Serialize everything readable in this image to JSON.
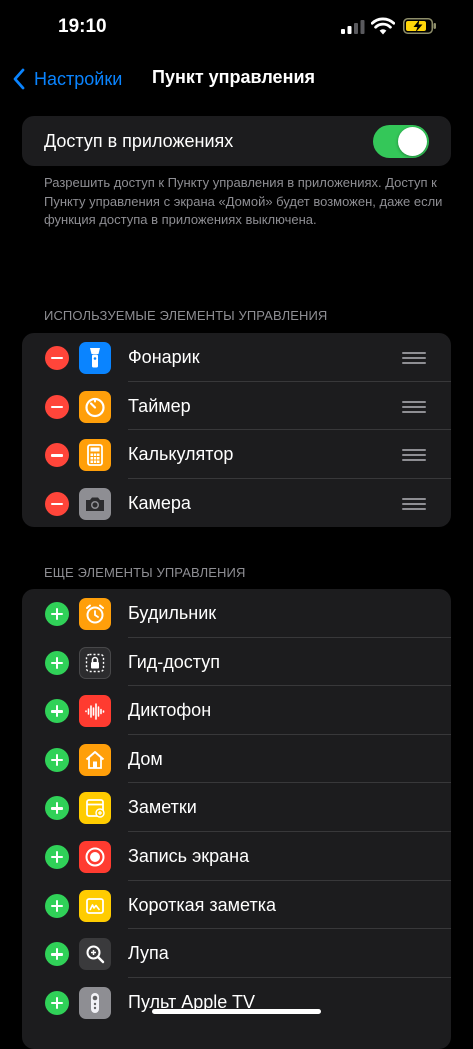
{
  "status_bar": {
    "time": "19:10"
  },
  "nav": {
    "back_label": "Настройки",
    "title": "Пункт управления"
  },
  "access": {
    "label": "Доступ в приложениях",
    "enabled": true,
    "footnote": "Разрешить доступ к Пункту управления в приложениях. Доступ к Пункту управления с экрана «Домой» будет возможен, даже если функция доступа в приложениях выключена."
  },
  "included": {
    "header": "ИСПОЛЬЗУЕМЫЕ ЭЛЕМЕНТЫ УПРАВЛЕНИЯ",
    "items": [
      {
        "label": "Фонарик",
        "icon": "flashlight-icon",
        "color": "#0a84ff"
      },
      {
        "label": "Таймер",
        "icon": "timer-icon",
        "color": "#ff9f0a"
      },
      {
        "label": "Калькулятор",
        "icon": "calculator-icon",
        "color": "#ff9f0a"
      },
      {
        "label": "Камера",
        "icon": "camera-icon",
        "color": "#8e8e93"
      }
    ]
  },
  "more": {
    "header": "ЕЩЕ ЭЛЕМЕНТЫ УПРАВЛЕНИЯ",
    "items": [
      {
        "label": "Будильник",
        "icon": "alarm-icon",
        "color": "#ff9f0a"
      },
      {
        "label": "Гид-доступ",
        "icon": "guided-access-icon",
        "color": "#2c2c2e"
      },
      {
        "label": "Диктофон",
        "icon": "voice-memos-icon",
        "color": "#ff3b30"
      },
      {
        "label": "Дом",
        "icon": "home-icon",
        "color": "#ff9f0a"
      },
      {
        "label": "Заметки",
        "icon": "notes-icon",
        "color": "#ffcc00"
      },
      {
        "label": "Запись экрана",
        "icon": "screen-recording-icon",
        "color": "#ff3b30"
      },
      {
        "label": "Короткая заметка",
        "icon": "quick-note-icon",
        "color": "#ffcc00"
      },
      {
        "label": "Лупа",
        "icon": "magnifier-icon",
        "color": "#3a3a3c"
      },
      {
        "label": "Пульт Apple TV",
        "icon": "apple-tv-remote-icon",
        "color": "#8e8e93"
      }
    ]
  }
}
